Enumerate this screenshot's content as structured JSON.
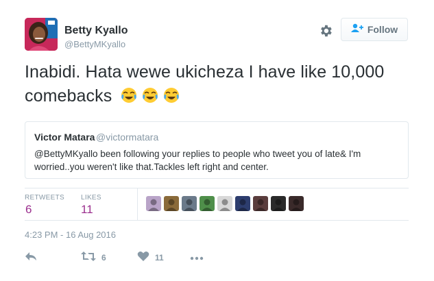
{
  "author": {
    "name": "Betty Kyallo",
    "handle": "@BettyMKyallo"
  },
  "follow_button": {
    "label": "Follow"
  },
  "tweet": {
    "text": "Inabidi. Hata wewe ukicheza I have like 10,000 comebacks",
    "emoji": [
      "face-with-tears-of-joy",
      "face-with-tears-of-joy",
      "face-with-tears-of-joy"
    ]
  },
  "quoted_tweet": {
    "name": "Victor Matara",
    "handle": "@victormatara",
    "text": "@BettyMKyallo been following your replies to people who tweet you of late& I'm worried..you weren't like that.Tackles left right and center."
  },
  "stats": {
    "retweets_label": "RETWEETS",
    "retweets_value": "6",
    "likes_label": "LIKES",
    "likes_value": "11"
  },
  "likers": [
    {
      "name": "liker-avatar-1",
      "color": "#b9a4c8"
    },
    {
      "name": "liker-avatar-2",
      "color": "#8a6a3a"
    },
    {
      "name": "liker-avatar-3",
      "color": "#6b7a8a"
    },
    {
      "name": "liker-avatar-4",
      "color": "#4f8f4a"
    },
    {
      "name": "liker-avatar-5",
      "color": "#d8d8d8"
    },
    {
      "name": "liker-avatar-6",
      "color": "#2d3d6e"
    },
    {
      "name": "liker-avatar-7",
      "color": "#5a3d3d"
    },
    {
      "name": "liker-avatar-8",
      "color": "#2a2a2a"
    },
    {
      "name": "liker-avatar-9",
      "color": "#3a2a2a"
    }
  ],
  "timestamp": "4:23 PM - 16 Aug 2016",
  "actions": {
    "retweet_count": "6",
    "like_count": "11"
  },
  "colors": {
    "accent": "#9b2f8e",
    "muted": "#8899a6",
    "border": "#e1e8ed"
  }
}
